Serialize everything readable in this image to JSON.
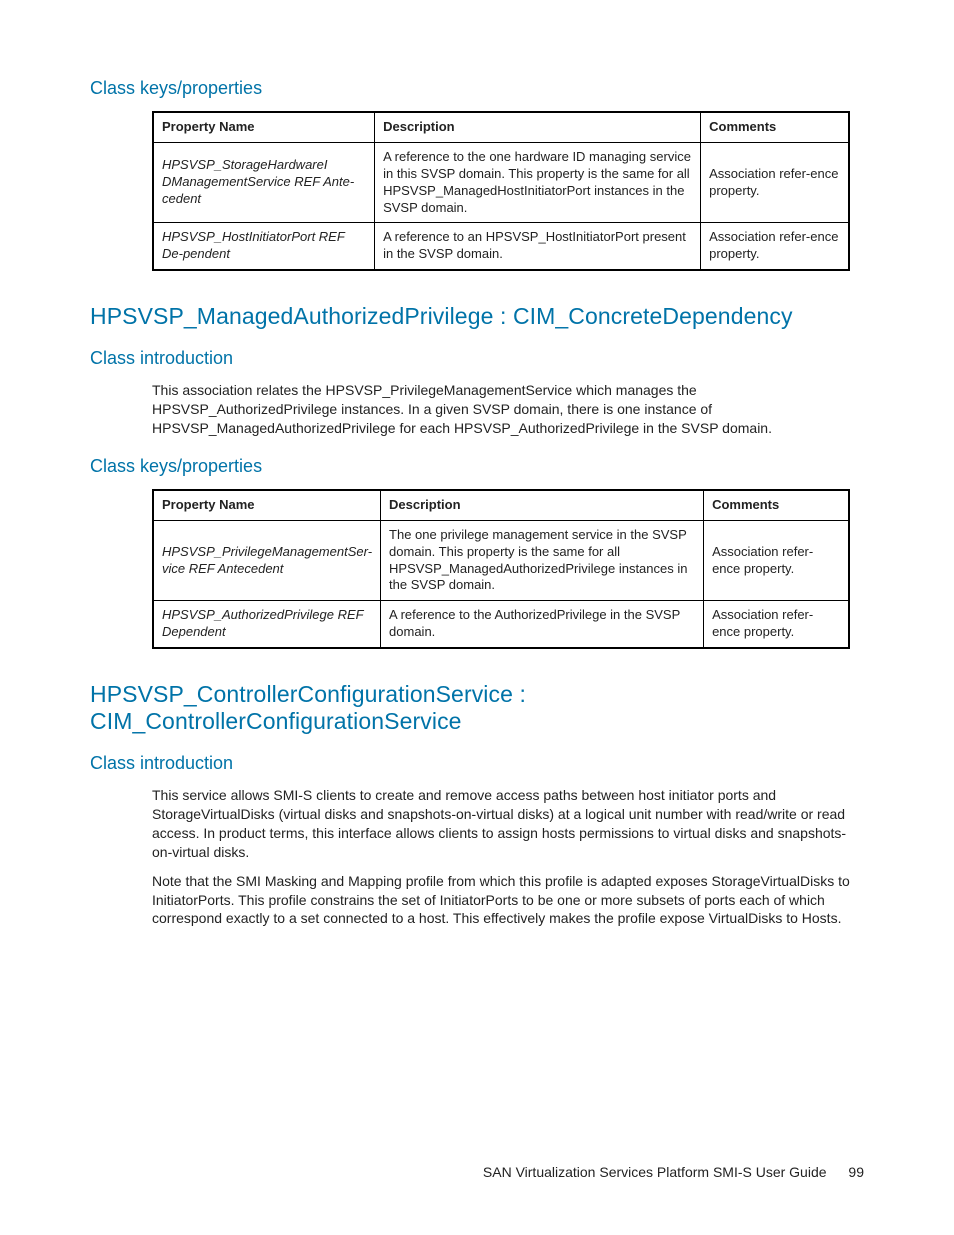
{
  "section1": {
    "keys_heading": "Class keys/properties",
    "table": {
      "headers": {
        "c1": "Property Name",
        "c2": "Description",
        "c3": "Comments"
      },
      "rows": [
        {
          "name": "HPSVSP_StorageHardwareI DManagementService REF Ante-cedent",
          "desc": "A reference to the one hardware ID managing service in this SVSP domain. This property is the same for all HPSVSP_ManagedHostInitiatorPort instances in the SVSP domain.",
          "comment": "Association refer-ence property."
        },
        {
          "name": "HPSVSP_HostInitiatorPort REF De-pendent",
          "desc": "A reference to an HPSVSP_HostInitiatorPort present in the SVSP domain.",
          "comment": "Association refer-ence property."
        }
      ]
    }
  },
  "section2": {
    "heading": "HPSVSP_ManagedAuthorizedPrivilege : CIM_ConcreteDependency",
    "intro_heading": "Class introduction",
    "intro_text": "This association relates the HPSVSP_PrivilegeManagementService which manages the HPSVSP_AuthorizedPrivilege instances. In a given SVSP domain, there is one instance of HPSVSP_ManagedAuthorizedPrivilege for each HPSVSP_AuthorizedPrivilege in the SVSP domain.",
    "keys_heading": "Class keys/properties",
    "table": {
      "headers": {
        "c1": "Property Name",
        "c2": "Description",
        "c3": "Comments"
      },
      "rows": [
        {
          "name": "HPSVSP_PrivilegeManagementSer-vice REF Antecedent",
          "desc": "The one privilege management service in the SVSP domain. This property is the same for all HPSVSP_ManagedAuthorizedPrivilege instances in the SVSP domain.",
          "comment": "Association refer-ence property."
        },
        {
          "name": "HPSVSP_AuthorizedPrivilege REF Dependent",
          "desc": "A reference to the AuthorizedPrivilege in the SVSP domain.",
          "comment": "Association refer-ence property."
        }
      ]
    }
  },
  "section3": {
    "heading": "HPSVSP_ControllerConfigurationService : CIM_ControllerConfigurationService",
    "intro_heading": "Class introduction",
    "intro_p1": "This service allows SMI-S clients to create and remove access paths between host initiator ports and StorageVirtualDisks (virtual disks and snapshots-on-virtual disks) at a logical unit number with read/write or read access. In product terms, this interface allows clients to assign hosts permissions to virtual disks and snapshots-on-virtual disks.",
    "intro_p2": "Note that the SMI Masking and Mapping profile from which this profile is adapted exposes StorageVirtualDisks to InitiatorPorts. This profile constrains the set of InitiatorPorts to be one or more subsets of ports each of which correspond exactly to a set connected to a host. This effectively makes the profile expose VirtualDisks to Hosts."
  },
  "footer": {
    "title": "SAN Virtualization Services Platform SMI-S User Guide",
    "page": "99"
  }
}
